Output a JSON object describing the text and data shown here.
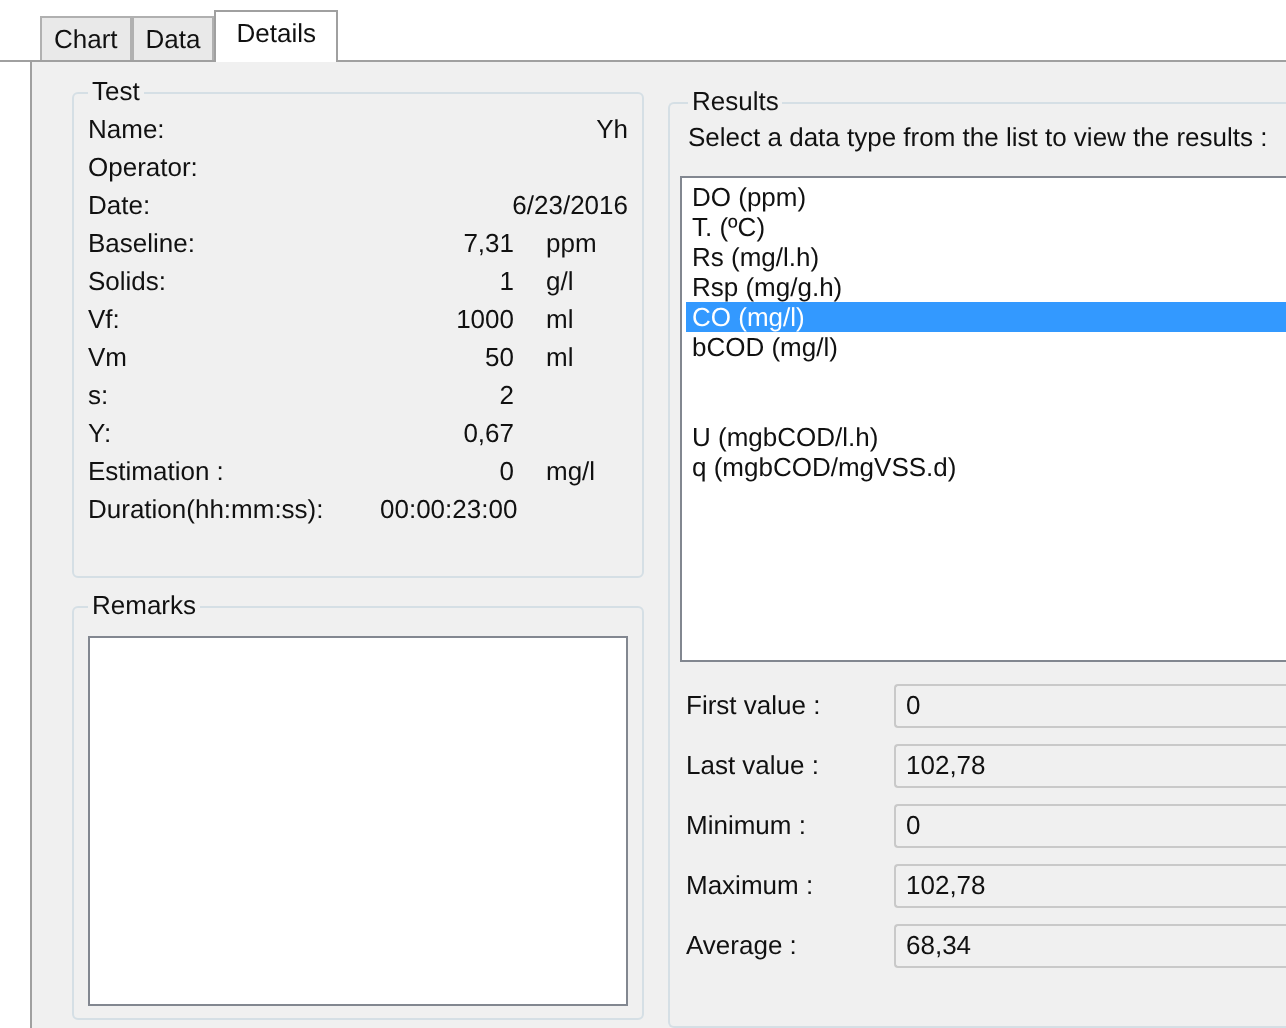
{
  "tabs": [
    {
      "label": "Chart",
      "selected": false
    },
    {
      "label": "Data",
      "selected": false
    },
    {
      "label": "Details",
      "selected": true
    }
  ],
  "test": {
    "title": "Test",
    "rows": [
      {
        "kind": "full",
        "label": "Name:",
        "value": "Yh"
      },
      {
        "kind": "full",
        "label": "Operator:"
      },
      {
        "kind": "full",
        "label": "Date:",
        "value": "6/23/2016"
      },
      {
        "kind": "measure",
        "label": "Baseline:",
        "value": "7,31",
        "unit": "ppm"
      },
      {
        "kind": "measure",
        "label": "Solids:",
        "value": "1",
        "unit": "g/l"
      },
      {
        "kind": "measure",
        "label": "Vf:",
        "value": "1000",
        "unit": "ml"
      },
      {
        "kind": "measure",
        "label": "Vm",
        "value": "50",
        "unit": "ml"
      },
      {
        "kind": "measure",
        "label": "s:",
        "value": "2"
      },
      {
        "kind": "measure",
        "label": "Y:",
        "value": "0,67"
      },
      {
        "kind": "measure",
        "label": "Estimation :",
        "value": "0",
        "unit": "mg/l"
      },
      {
        "kind": "long",
        "label": "Duration(hh:mm:ss):",
        "value": "00:00:23:00"
      }
    ]
  },
  "remarks": {
    "title": "Remarks"
  },
  "results": {
    "title": "Results",
    "instruction": "Select a data type from the list to view the results :",
    "groups": [
      [
        {
          "label": "DO (ppm)",
          "selected": false
        },
        {
          "label": "T. (ºC)",
          "selected": false
        },
        {
          "label": "Rs (mg/l.h)",
          "selected": false
        },
        {
          "label": "Rsp (mg/g.h)",
          "selected": false
        },
        {
          "label": "CO (mg/l)",
          "selected": true
        },
        {
          "label": "bCOD (mg/l)",
          "selected": false
        }
      ],
      [
        {
          "label": "U (mgbCOD/l.h)",
          "selected": false
        },
        {
          "label": "q (mgbCOD/mgVSS.d)",
          "selected": false
        }
      ]
    ],
    "stats": [
      {
        "label": "First value :",
        "value": "0"
      },
      {
        "label": "Last value :",
        "value": "102,78"
      },
      {
        "label": "Minimum :",
        "value": "0"
      },
      {
        "label": "Maximum :",
        "value": "102,78"
      },
      {
        "label": "Average :",
        "value": "68,34"
      }
    ]
  }
}
